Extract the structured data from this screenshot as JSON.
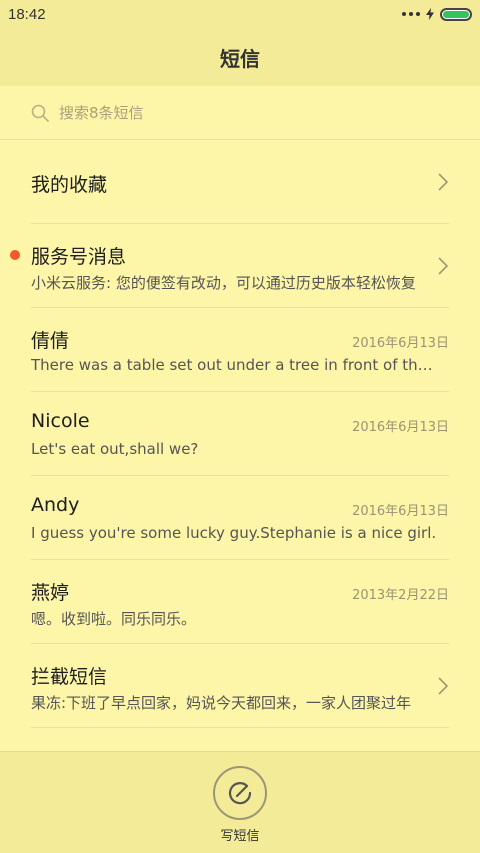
{
  "status_bar": {
    "time": "18:42"
  },
  "header": {
    "title": "短信"
  },
  "search": {
    "placeholder": "搜索8条短信",
    "icon": "search-icon"
  },
  "conversations": [
    {
      "name": "我的收藏",
      "preview": "",
      "date": "",
      "type": "folder",
      "unread": false
    },
    {
      "name": "服务号消息",
      "preview": "小米云服务: 您的便签有改动，可以通过历史版本轻松恢复",
      "date": "",
      "type": "folder",
      "unread": true
    },
    {
      "name": "倩倩",
      "preview": "There was a table set out under a tree in front of the house",
      "date": "2016年6月13日",
      "type": "thread",
      "unread": false
    },
    {
      "name": "Nicole",
      "preview": "Let's eat out,shall we?",
      "date": "2016年6月13日",
      "type": "thread",
      "unread": false
    },
    {
      "name": "Andy",
      "preview": "I guess you're some lucky guy.Stephanie is a nice girl.",
      "date": "2016年6月13日",
      "type": "thread",
      "unread": false
    },
    {
      "name": "燕婷",
      "preview": "嗯。收到啦。同乐同乐。",
      "date": "2013年2月22日",
      "type": "thread",
      "unread": false
    },
    {
      "name": "拦截短信",
      "preview": "果冻:下班了早点回家，妈说今天都回来，一家人团聚过年",
      "date": "",
      "type": "folder",
      "unread": false
    }
  ],
  "compose": {
    "label": "写短信",
    "icon": "compose-icon"
  },
  "colors": {
    "background": "#fdf5a8",
    "bar": "#f4eb98",
    "unread": "#f2592c",
    "battery": "#36c45a"
  }
}
